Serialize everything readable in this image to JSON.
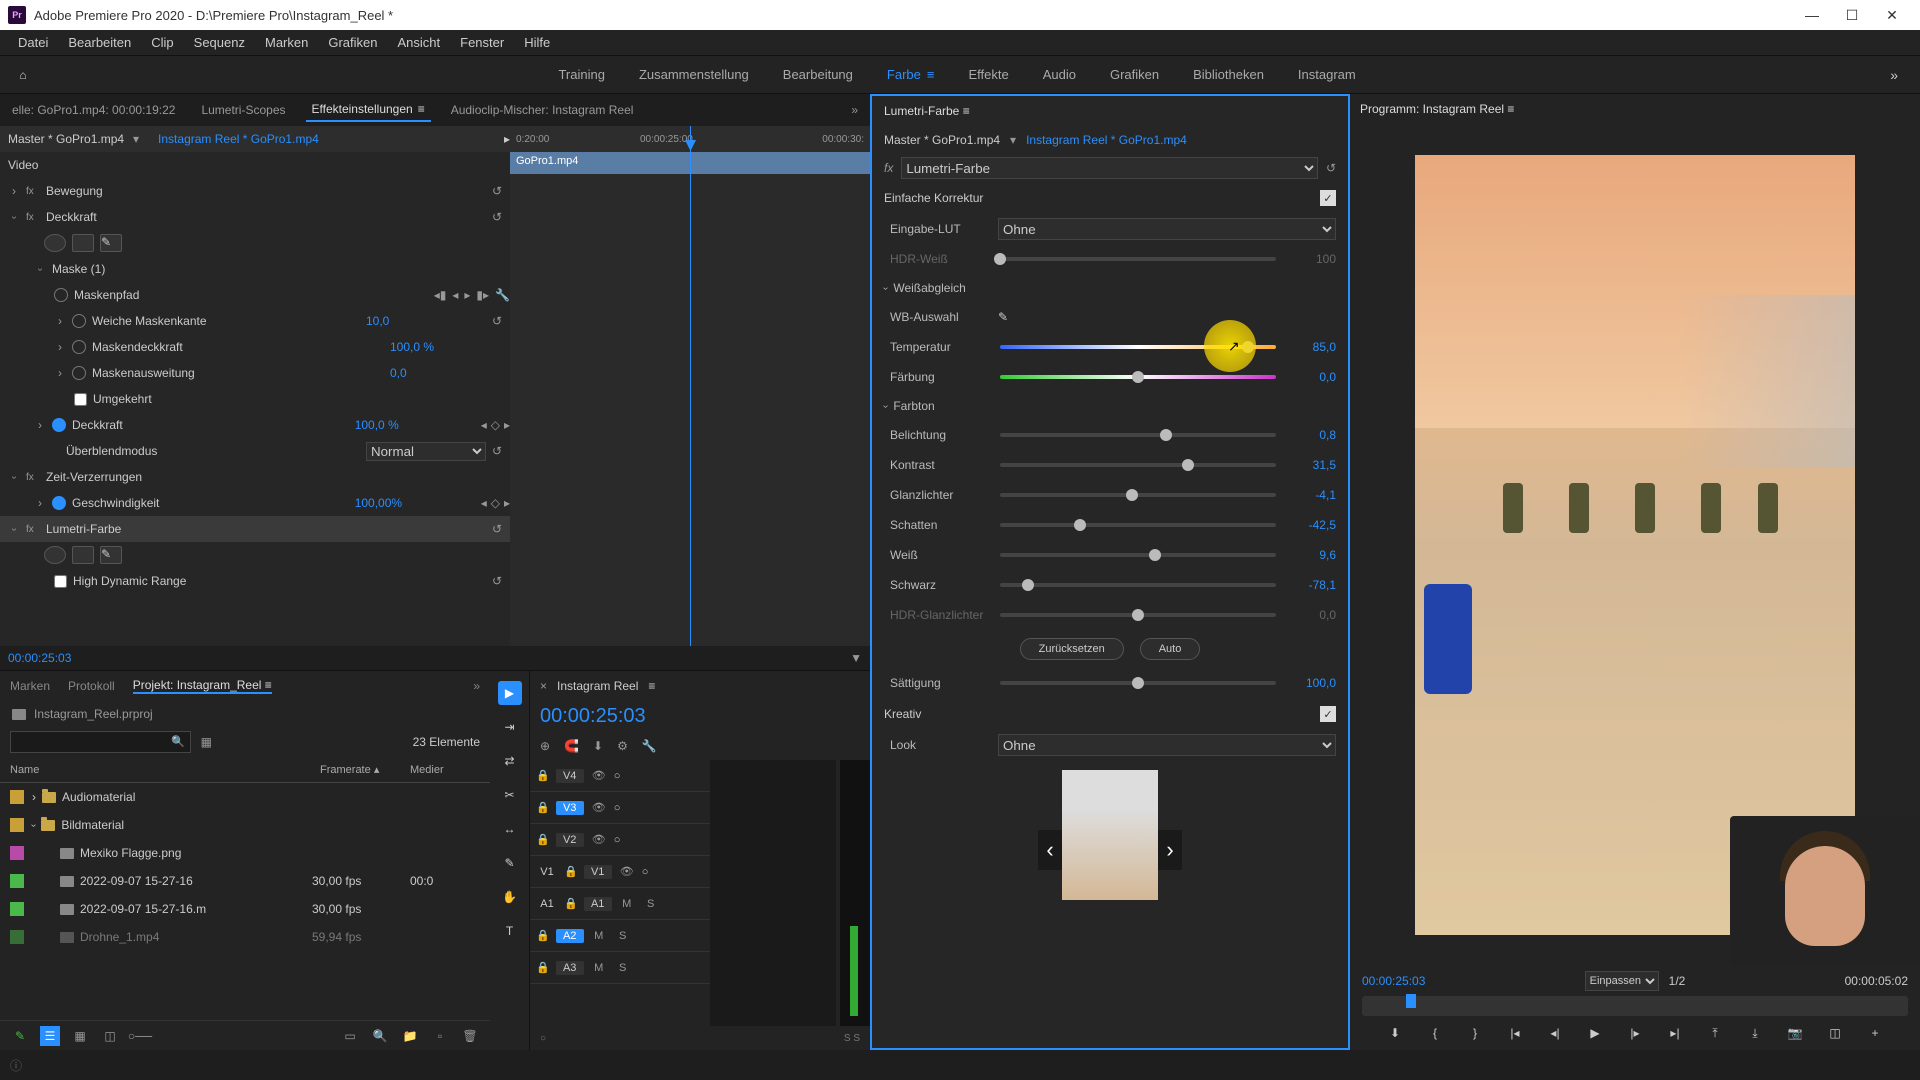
{
  "title_bar": {
    "app_icon": "Pr",
    "title": "Adobe Premiere Pro 2020 - D:\\Premiere Pro\\Instagram_Reel *",
    "minimize": "—",
    "maximize": "☐",
    "close": "✕"
  },
  "menu": [
    "Datei",
    "Bearbeiten",
    "Clip",
    "Sequenz",
    "Marken",
    "Grafiken",
    "Ansicht",
    "Fenster",
    "Hilfe"
  ],
  "workspaces": {
    "home_icon": "⌂",
    "tabs": [
      "Training",
      "Zusammenstellung",
      "Bearbeitung",
      "Farbe",
      "Effekte",
      "Audio",
      "Grafiken",
      "Bibliotheken",
      "Instagram"
    ],
    "active": "Farbe",
    "more": "»"
  },
  "effect_tabs": {
    "items": [
      "elle: GoPro1.mp4: 00:00:19:22",
      "Lumetri-Scopes",
      "Effekteinstellungen",
      "Audioclip-Mischer: Instagram Reel"
    ],
    "active_index": 2,
    "more": "»"
  },
  "effect_controls": {
    "master": "Master * GoPro1.mp4",
    "sequence": "Instagram Reel * GoPro1.mp4",
    "times": [
      "0:20:00",
      "00:00:25:00",
      "00:00:30:"
    ],
    "clip_label": "GoPro1.mp4",
    "video_header": "Video",
    "rows": [
      {
        "label": "Bewegung",
        "type": "fx"
      },
      {
        "label": "Deckkraft",
        "type": "fx"
      },
      {
        "label": "Maske (1)",
        "type": "sub"
      },
      {
        "label": "Maskenpfad",
        "type": "leaf"
      },
      {
        "label": "Weiche Maskenkante",
        "value": "10,0",
        "type": "leaf"
      },
      {
        "label": "Maskendeckkraft",
        "value": "100,0 %",
        "type": "leaf"
      },
      {
        "label": "Maskenausweitung",
        "value": "0,0",
        "type": "leaf"
      },
      {
        "label": "Umgekehrt",
        "type": "check"
      },
      {
        "label": "Deckkraft",
        "value": "100,0 %",
        "type": "kf"
      },
      {
        "label": "Überblendmodus",
        "value": "Normal",
        "type": "select"
      },
      {
        "label": "Zeit-Verzerrungen",
        "type": "fx"
      },
      {
        "label": "Geschwindigkeit",
        "value": "100,00%",
        "type": "kf"
      },
      {
        "label": "Lumetri-Farbe",
        "type": "fx-selected"
      },
      {
        "label": "High Dynamic Range",
        "type": "check"
      }
    ],
    "current_time": "00:00:25:03"
  },
  "project": {
    "tabs": [
      "Marken",
      "Protokoll",
      "Projekt: Instagram_Reel"
    ],
    "active_index": 2,
    "filename": "Instagram_Reel.prproj",
    "count": "23 Elemente",
    "headers": {
      "name": "Name",
      "framerate": "Framerate",
      "media": "Medier"
    },
    "rows": [
      {
        "color": "#c9a038",
        "name": "Audiomaterial",
        "framerate": "",
        "media": "",
        "folder": true,
        "expanded": false
      },
      {
        "color": "#c9a038",
        "name": "Bildmaterial",
        "framerate": "",
        "media": "",
        "folder": true,
        "expanded": true
      },
      {
        "color": "#b84aa8",
        "name": "Mexiko Flagge.png",
        "framerate": "",
        "media": "",
        "folder": false,
        "indent": true
      },
      {
        "color": "#4ab84a",
        "name": "2022-09-07 15-27-16",
        "framerate": "30,00 fps",
        "media": "00:0",
        "folder": false,
        "indent": true
      },
      {
        "color": "#4ab84a",
        "name": "2022-09-07 15-27-16.m",
        "framerate": "30,00 fps",
        "media": "",
        "folder": false,
        "indent": true
      },
      {
        "color": "#4ab84a",
        "name": "Drohne_1.mp4",
        "framerate": "59,94 fps",
        "media": "",
        "folder": false,
        "indent": true,
        "cut": true
      }
    ]
  },
  "timeline": {
    "seq_name": "Instagram Reel",
    "timecode": "00:00:25:03",
    "tracks_v": [
      "V4",
      "V3",
      "V2",
      "V1"
    ],
    "tracks_a": [
      "A1",
      "A2",
      "A3"
    ],
    "active_v": "V3",
    "active_a": "A2",
    "snap_label": "S  S"
  },
  "lumetri": {
    "panel_name": "Lumetri-Farbe",
    "master": "Master * GoPro1.mp4",
    "sequence": "Instagram Reel * GoPro1.mp4",
    "fx_label": "fx",
    "fx_name": "Lumetri-Farbe",
    "sections": {
      "basic": {
        "title": "Einfache Korrektur",
        "enabled": true
      },
      "lut": {
        "label": "Eingabe-LUT",
        "value": "Ohne"
      },
      "hdr_white": {
        "label": "HDR-Weiß",
        "value": "100"
      },
      "wb": {
        "title": "Weißabgleich"
      },
      "wb_pick": {
        "label": "WB-Auswahl"
      },
      "temperature": {
        "label": "Temperatur",
        "value": "85,0",
        "pos": 90
      },
      "tint": {
        "label": "Färbung",
        "value": "0,0",
        "pos": 50
      },
      "tone": {
        "title": "Farbton"
      },
      "exposure": {
        "label": "Belichtung",
        "value": "0,8",
        "pos": 60
      },
      "contrast": {
        "label": "Kontrast",
        "value": "31,5",
        "pos": 68
      },
      "highlights": {
        "label": "Glanzlichter",
        "value": "-4,1",
        "pos": 48
      },
      "shadows": {
        "label": "Schatten",
        "value": "-42,5",
        "pos": 29
      },
      "whites": {
        "label": "Weiß",
        "value": "9,6",
        "pos": 56
      },
      "blacks": {
        "label": "Schwarz",
        "value": "-78,1",
        "pos": 10
      },
      "hdr_spec": {
        "label": "HDR-Glanzlichter",
        "value": "0,0",
        "pos": 50
      },
      "reset": "Zurücksetzen",
      "auto": "Auto",
      "saturation": {
        "label": "Sättigung",
        "value": "100,0",
        "pos": 50
      },
      "creative": {
        "title": "Kreativ",
        "enabled": true
      },
      "look": {
        "label": "Look",
        "value": "Ohne"
      }
    }
  },
  "program": {
    "title": "Programm: Instagram Reel",
    "timecode": "00:00:25:03",
    "fit": "Einpassen",
    "zoom": "1/2",
    "duration": "00:00:05:02"
  }
}
